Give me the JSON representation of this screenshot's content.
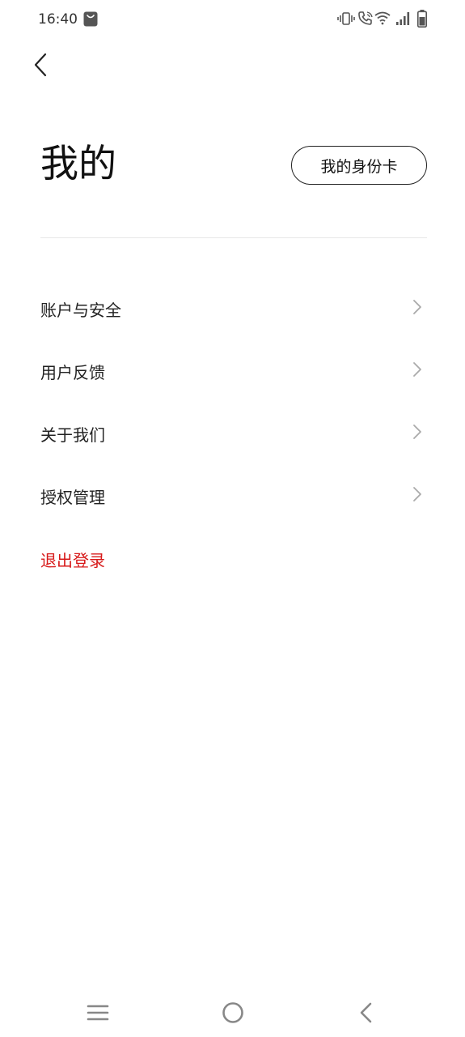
{
  "status_bar": {
    "time": "16:40",
    "icons": [
      "shopping-bag-icon",
      "vibrate-icon",
      "wifi-calling-icon",
      "wifi-icon",
      "signal-icon",
      "battery-icon"
    ]
  },
  "header": {
    "back_icon": "chevron-left-icon",
    "title": "我的",
    "id_card_button": "我的身份卡"
  },
  "menu": {
    "items": [
      {
        "label": "账户与安全",
        "icon": "chevron-right-icon"
      },
      {
        "label": "用户反馈",
        "icon": "chevron-right-icon"
      },
      {
        "label": "关于我们",
        "icon": "chevron-right-icon"
      },
      {
        "label": "授权管理",
        "icon": "chevron-right-icon"
      }
    ],
    "logout": "退出登录"
  },
  "nav_bar": {
    "icons": [
      "menu-icon",
      "home-icon",
      "back-icon"
    ]
  },
  "colors": {
    "accent_red": "#d71a1a",
    "text": "#222222",
    "divider": "#e8e8e8"
  }
}
